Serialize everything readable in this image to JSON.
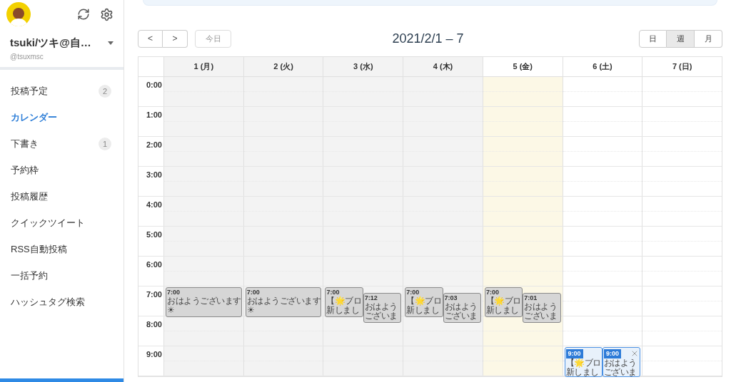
{
  "account": {
    "name": "tsuki/ツキ@自…",
    "handle": "@tsuxmsc"
  },
  "nav": [
    {
      "label": "投稿予定",
      "count": "2",
      "selected": false
    },
    {
      "label": "カレンダー",
      "selected": true
    },
    {
      "label": "下書き",
      "count": "1",
      "selected": false
    },
    {
      "label": "予約枠",
      "selected": false
    },
    {
      "label": "投稿履歴",
      "selected": false
    },
    {
      "label": "クイックツイート",
      "selected": false
    },
    {
      "label": "RSS自動投稿",
      "selected": false
    },
    {
      "label": "一括予約",
      "selected": false
    },
    {
      "label": "ハッシュタグ検索",
      "selected": false
    }
  ],
  "toolbar": {
    "prev": "<",
    "next": ">",
    "today": "今日",
    "title": "2021/2/1 – 7",
    "views": [
      {
        "label": "日",
        "selected": false
      },
      {
        "label": "週",
        "selected": true
      },
      {
        "label": "月",
        "selected": false
      }
    ]
  },
  "days": [
    {
      "label": "1 (月)",
      "kind": "past"
    },
    {
      "label": "2 (火)",
      "kind": "past"
    },
    {
      "label": "3 (水)",
      "kind": "past"
    },
    {
      "label": "4 (木)",
      "kind": "past"
    },
    {
      "label": "5 (金)",
      "kind": "today"
    },
    {
      "label": "6 (土)",
      "kind": "future"
    },
    {
      "label": "7 (日)",
      "kind": "future"
    }
  ],
  "rows": [
    {
      "time": "0:00"
    },
    {
      "time": "1:00"
    },
    {
      "time": "2:00"
    },
    {
      "time": "3:00"
    },
    {
      "time": "4:00"
    },
    {
      "time": "5:00"
    },
    {
      "time": "6:00"
    },
    {
      "time": "7:00",
      "cells": [
        {
          "events": [
            {
              "kind": "posted",
              "time": "7:00",
              "lines": [
                "おはようございます",
                "☀"
              ]
            }
          ]
        },
        {
          "events": [
            {
              "kind": "posted",
              "time": "7:00",
              "lines": [
                "おはようございます",
                "☀"
              ]
            }
          ]
        },
        {
          "events": [
            {
              "kind": "posted",
              "time": "7:00",
              "lines": [
                "【🌟ブロ",
                "新しまし"
              ]
            },
            {
              "kind": "posted",
              "time": "7:12",
              "lines": [
                "おはよう",
                "ございま"
              ]
            }
          ]
        },
        {
          "events": [
            {
              "kind": "posted",
              "time": "7:00",
              "lines": [
                "【🌟ブロ",
                "新しまし"
              ]
            },
            {
              "kind": "posted",
              "time": "7:03",
              "lines": [
                "おはよう",
                "ございま"
              ]
            }
          ]
        },
        {
          "events": [
            {
              "kind": "posted",
              "time": "7:00",
              "lines": [
                "【🌟ブロ",
                "新しまし"
              ]
            },
            {
              "kind": "posted",
              "time": "7:01",
              "lines": [
                "おはよう",
                "ございま"
              ]
            }
          ]
        },
        {},
        {}
      ]
    },
    {
      "time": "8:00"
    },
    {
      "time": "9:00",
      "cells": [
        {},
        {},
        {},
        {},
        {},
        {
          "events": [
            {
              "kind": "scheduled",
              "time": "9:00",
              "lines": [
                "【🌟ブロ",
                "新しまし"
              ]
            },
            {
              "kind": "scheduled",
              "time": "9:00",
              "lines": [
                "おはよう",
                "ございま"
              ],
              "closable": true
            }
          ]
        },
        {}
      ]
    }
  ]
}
